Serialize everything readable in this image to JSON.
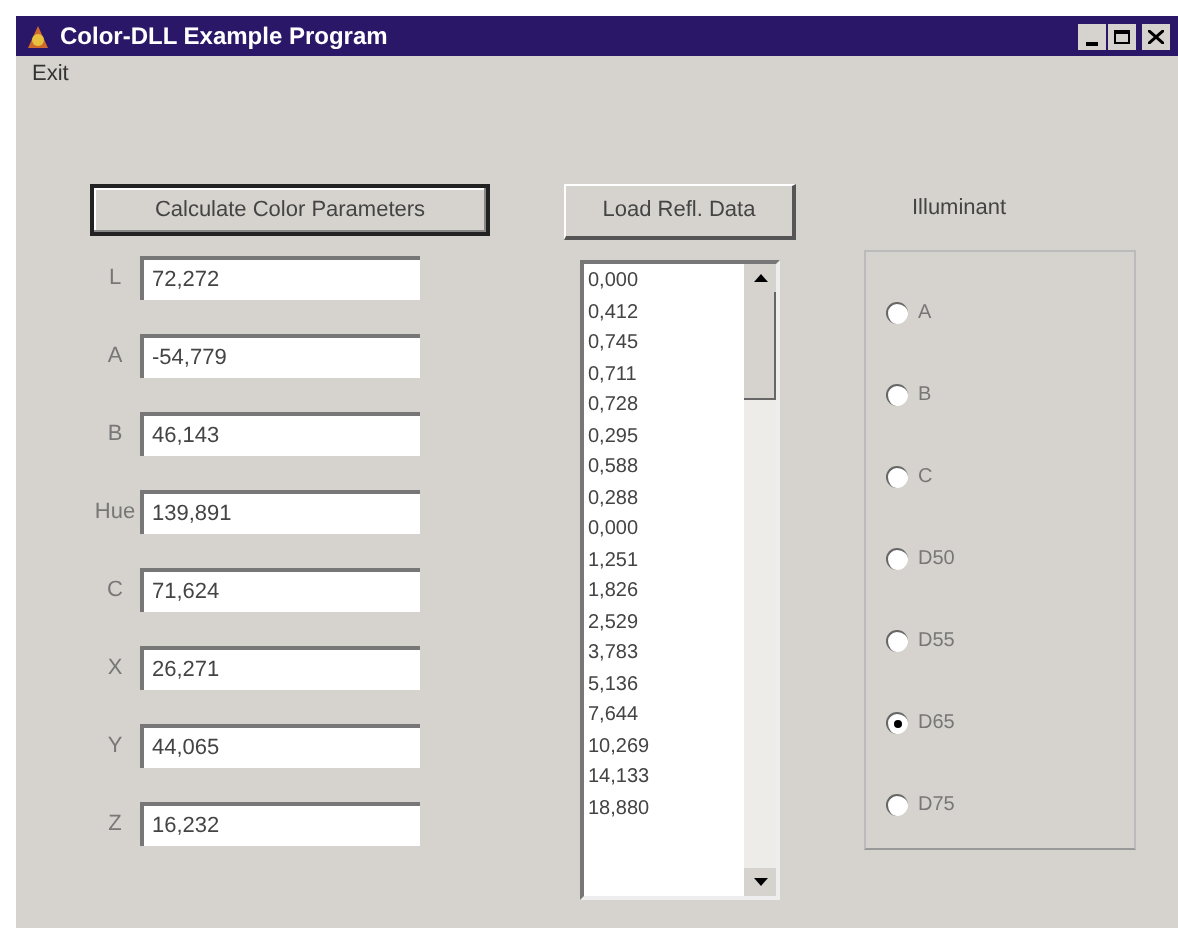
{
  "window": {
    "title": "Color-DLL Example Program"
  },
  "menu": [
    "Exit"
  ],
  "calculate_button": "Calculate Color Parameters",
  "fields": [
    {
      "label": "L",
      "value": "72,272"
    },
    {
      "label": "A",
      "value": "-54,779"
    },
    {
      "label": "B",
      "value": "46,143"
    },
    {
      "label": "Hue",
      "value": "139,891"
    },
    {
      "label": "C",
      "value": "71,624"
    },
    {
      "label": "X",
      "value": "26,271"
    },
    {
      "label": "Y",
      "value": "44,065"
    },
    {
      "label": "Z",
      "value": "16,232"
    }
  ],
  "load_button": "Load Refl. Data",
  "reflectance_list": [
    "0,000",
    "0,412",
    "0,745",
    "0,711",
    "0,728",
    "0,295",
    "0,588",
    "0,288",
    "0,000",
    "1,251",
    "1,826",
    "2,529",
    "3,783",
    "5,136",
    "7,644",
    "10,269",
    "14,133",
    "18,880"
  ],
  "illuminant": {
    "title": "Illuminant",
    "options": [
      {
        "label": "A",
        "selected": false
      },
      {
        "label": "B",
        "selected": false
      },
      {
        "label": "C",
        "selected": false
      },
      {
        "label": "D50",
        "selected": false
      },
      {
        "label": "D55",
        "selected": false
      },
      {
        "label": "D65",
        "selected": true
      },
      {
        "label": "D75",
        "selected": false
      }
    ]
  }
}
